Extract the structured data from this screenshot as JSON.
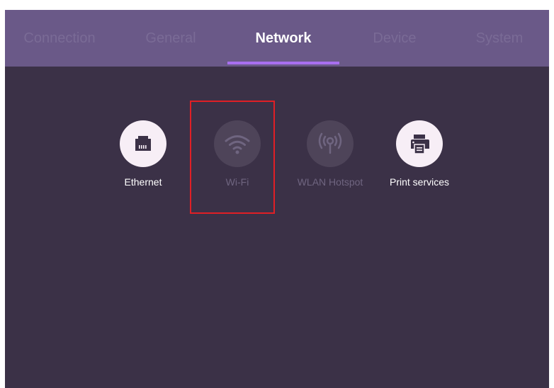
{
  "tabs": [
    {
      "label": "Connection",
      "active": false
    },
    {
      "label": "General",
      "active": false
    },
    {
      "label": "Network",
      "active": true
    },
    {
      "label": "Device",
      "active": false
    },
    {
      "label": "System",
      "active": false
    }
  ],
  "options": [
    {
      "label": "Ethernet",
      "icon": "ethernet-icon",
      "enabled": true
    },
    {
      "label": "Wi-Fi",
      "icon": "wifi-icon",
      "enabled": false
    },
    {
      "label": "WLAN Hotspot",
      "icon": "hotspot-icon",
      "enabled": false
    },
    {
      "label": "Print services",
      "icon": "printer-icon",
      "enabled": true
    }
  ],
  "colors": {
    "background": "#3b3147",
    "tab_bar": "#6a5988",
    "active_indicator": "#a86ff0",
    "highlight_box": "#e01f25"
  }
}
